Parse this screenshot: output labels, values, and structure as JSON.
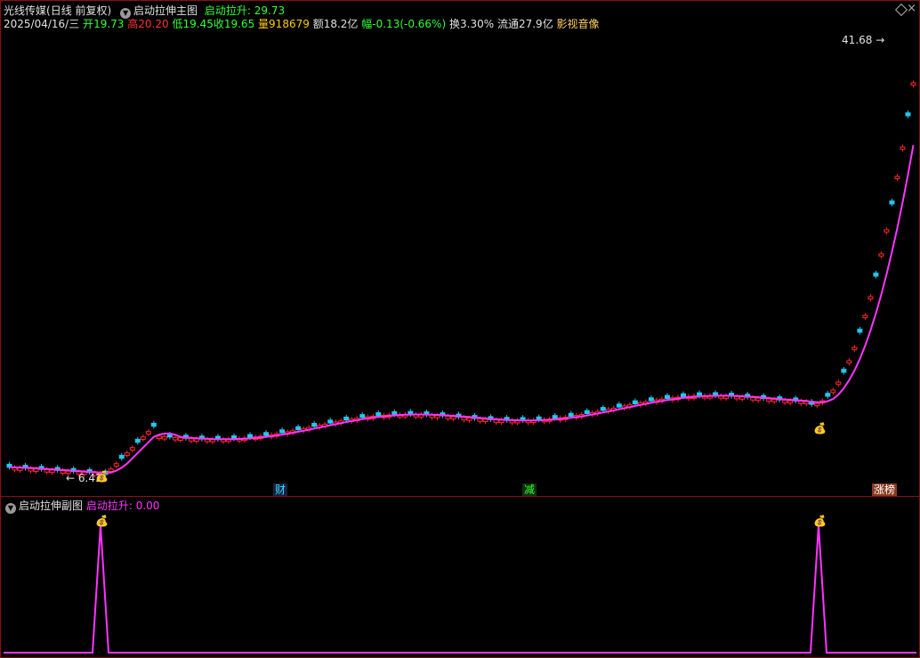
{
  "header": {
    "stock_name": "光线传媒",
    "period": "(日线 前复权)",
    "indicator_name": "启动拉伸主图",
    "indicator_value_label": "启动拉升:",
    "indicator_value": "29.73"
  },
  "quote": {
    "date": "2025/04/16/三",
    "open_label": "开",
    "open": "19.73",
    "high_label": "高",
    "high": "20.20",
    "low_label": "低",
    "low": "19.45",
    "close_label": "收",
    "close": "19.65",
    "volume_label": "量",
    "volume": "918679",
    "amount_label": "额",
    "amount": "18.2亿",
    "change_label": "幅",
    "change": "-0.13(-0.66%)",
    "turnover_label": "换",
    "turnover": "3.30%",
    "float_label": "流通",
    "float_cap": "27.9亿",
    "sector": "影视音像"
  },
  "main_chart": {
    "max_price_label": "41.68",
    "min_price_label": "6.43",
    "event_markers": [
      "财",
      "减",
      "涨榜"
    ]
  },
  "sub_chart": {
    "indicator_name": "启动拉伸副图",
    "indicator_value_label": "启动拉升:",
    "indicator_value": "0.00"
  },
  "colors": {
    "up": "#ff2b2b",
    "down": "#20c8f0",
    "ma_up": "#ff33ff",
    "ma_down": "#33ff33",
    "border": "#8a1010",
    "signal": "#ff33ff"
  },
  "chart_data": {
    "type": "candlestick",
    "x_end_date": "2025/04/16",
    "y_max_marked": 41.68,
    "y_min_marked": 6.43
  }
}
